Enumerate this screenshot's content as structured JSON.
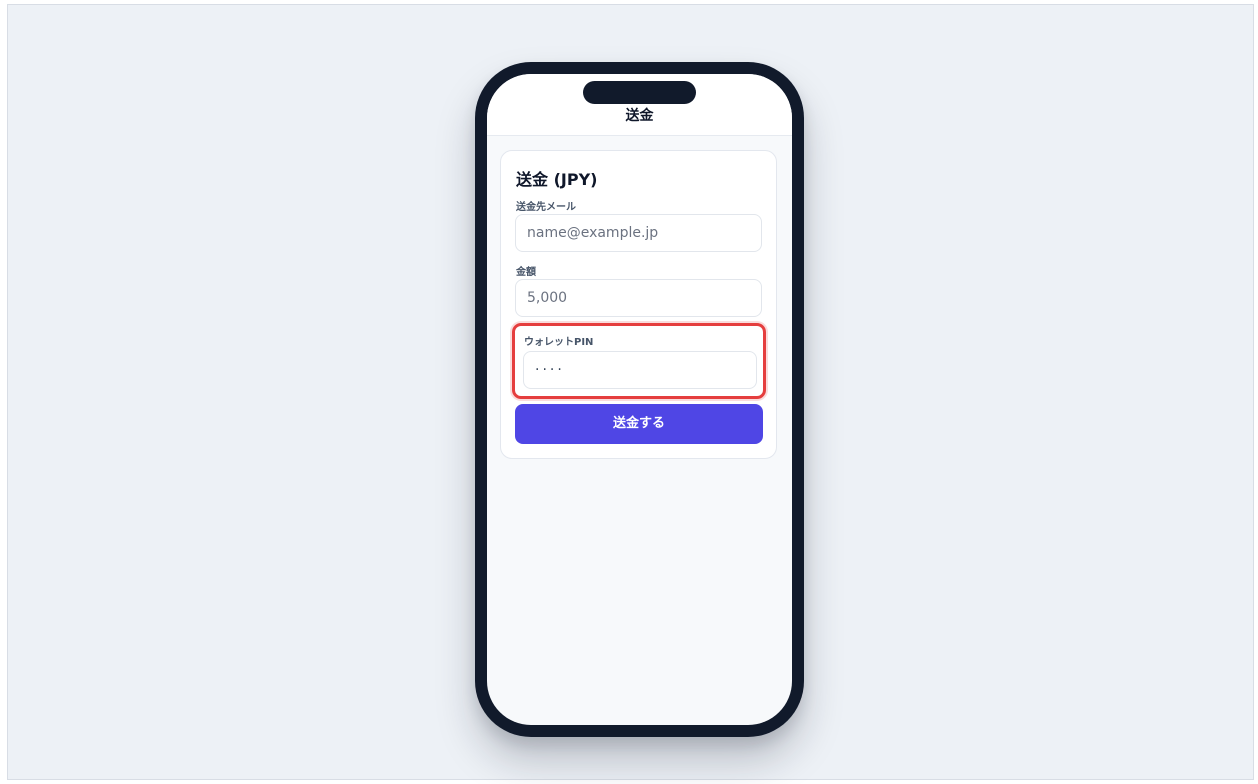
{
  "topbar": {
    "title": "送金"
  },
  "card": {
    "title": "送金 (JPY)",
    "recipient": {
      "label": "送金先メール",
      "placeholder": "name@example.jp"
    },
    "amount": {
      "label": "金額",
      "value": "5,000"
    },
    "pin": {
      "label": "ウォレットPIN",
      "value": "····"
    },
    "submit_label": "送金する"
  },
  "colors": {
    "accent": "#4f46e5",
    "highlight": "#e53e3e",
    "frame": "#111a2b"
  }
}
